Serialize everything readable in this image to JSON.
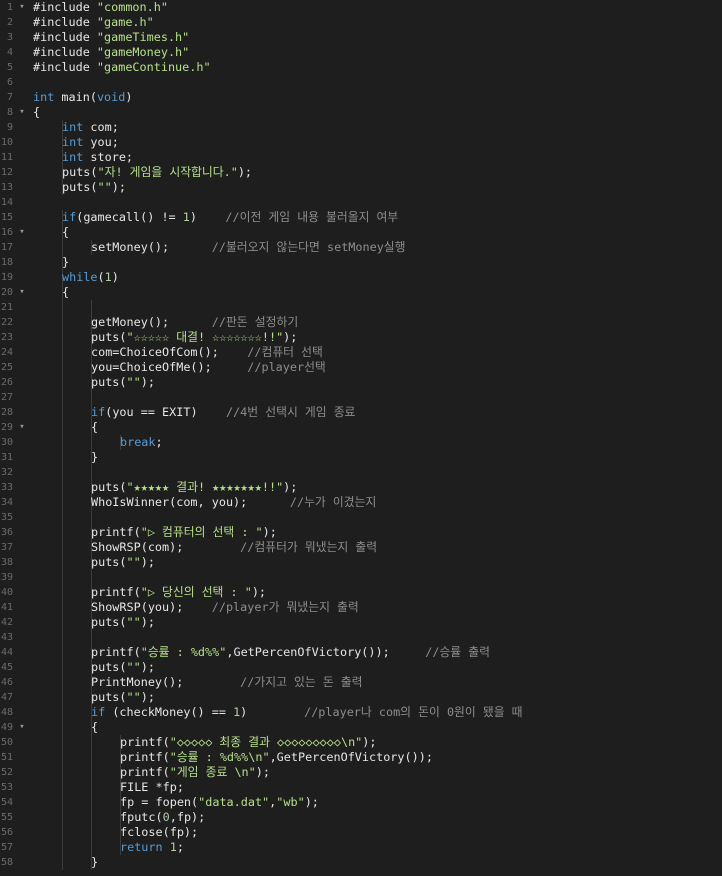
{
  "editor": {
    "colors": {
      "background": "#1e1e1e",
      "keyword": "#569cd6",
      "string": "#b5e08a",
      "comment": "#8e8e8e",
      "number": "#b5cea8",
      "plain": "#e6e6e6",
      "line_number": "#6b6b6b"
    },
    "lines": [
      {
        "n": "1",
        "fold": true,
        "depth": 0,
        "toks": [
          [
            "p",
            "#include "
          ],
          [
            "s",
            "\"common.h\""
          ]
        ]
      },
      {
        "n": "2",
        "depth": 0,
        "toks": [
          [
            "p",
            "#include "
          ],
          [
            "s",
            "\"game.h\""
          ]
        ]
      },
      {
        "n": "3",
        "depth": 0,
        "toks": [
          [
            "p",
            "#include "
          ],
          [
            "s",
            "\"gameTimes.h\""
          ]
        ]
      },
      {
        "n": "4",
        "depth": 0,
        "toks": [
          [
            "p",
            "#include "
          ],
          [
            "s",
            "\"gameMoney.h\""
          ]
        ]
      },
      {
        "n": "5",
        "depth": 0,
        "toks": [
          [
            "p",
            "#include "
          ],
          [
            "s",
            "\"gameContinue.h\""
          ]
        ]
      },
      {
        "n": "6",
        "depth": 0,
        "toks": []
      },
      {
        "n": "7",
        "depth": 0,
        "toks": [
          [
            "k",
            "int"
          ],
          [
            "p",
            " main("
          ],
          [
            "k",
            "void"
          ],
          [
            "p",
            ")"
          ]
        ]
      },
      {
        "n": "8",
        "fold": true,
        "depth": 0,
        "toks": [
          [
            "p",
            "{"
          ]
        ]
      },
      {
        "n": "9",
        "depth": 2,
        "toks": [
          [
            "k",
            "int"
          ],
          [
            "p",
            " com;"
          ]
        ]
      },
      {
        "n": "10",
        "depth": 2,
        "toks": [
          [
            "k",
            "int"
          ],
          [
            "p",
            " you;"
          ]
        ]
      },
      {
        "n": "11",
        "depth": 2,
        "toks": [
          [
            "k",
            "int"
          ],
          [
            "p",
            " store;"
          ]
        ]
      },
      {
        "n": "12",
        "depth": 2,
        "toks": [
          [
            "p",
            "puts("
          ],
          [
            "s",
            "\"자! 게임을 시작합니다.\""
          ],
          [
            "p",
            ");"
          ]
        ]
      },
      {
        "n": "13",
        "depth": 2,
        "toks": [
          [
            "p",
            "puts("
          ],
          [
            "s",
            "\"\""
          ],
          [
            "p",
            ");"
          ]
        ]
      },
      {
        "n": "14",
        "depth": 1,
        "toks": []
      },
      {
        "n": "15",
        "depth": 2,
        "toks": [
          [
            "k",
            "if"
          ],
          [
            "p",
            "(gamecall() != "
          ],
          [
            "n",
            "1"
          ],
          [
            "p",
            ")    "
          ],
          [
            "c",
            "//이전 게임 내용 불러올지 여부"
          ]
        ]
      },
      {
        "n": "16",
        "fold": true,
        "depth": 2,
        "toks": [
          [
            "p",
            "{"
          ]
        ]
      },
      {
        "n": "17",
        "depth": 3,
        "toks": [
          [
            "p",
            "setMoney();      "
          ],
          [
            "c",
            "//불러오지 않는다면 setMoney실행"
          ]
        ]
      },
      {
        "n": "18",
        "depth": 2,
        "toks": [
          [
            "p",
            "}"
          ]
        ]
      },
      {
        "n": "19",
        "depth": 2,
        "toks": [
          [
            "k",
            "while"
          ],
          [
            "p",
            "("
          ],
          [
            "n",
            "1"
          ],
          [
            "p",
            ")"
          ]
        ]
      },
      {
        "n": "20",
        "fold": true,
        "depth": 2,
        "toks": [
          [
            "p",
            "{"
          ]
        ]
      },
      {
        "n": "21",
        "depth": 3,
        "toks": []
      },
      {
        "n": "22",
        "depth": 3,
        "toks": [
          [
            "p",
            "getMoney();      "
          ],
          [
            "c",
            "//판돈 설정하기"
          ]
        ]
      },
      {
        "n": "23",
        "depth": 3,
        "toks": [
          [
            "p",
            "puts("
          ],
          [
            "s",
            "\"☆☆☆☆☆ 대결! ☆☆☆☆☆☆☆!!\""
          ],
          [
            "p",
            ");"
          ]
        ]
      },
      {
        "n": "24",
        "depth": 3,
        "toks": [
          [
            "p",
            "com=ChoiceOfCom();    "
          ],
          [
            "c",
            "//컴퓨터 선택"
          ]
        ]
      },
      {
        "n": "25",
        "depth": 3,
        "toks": [
          [
            "p",
            "you=ChoiceOfMe();     "
          ],
          [
            "c",
            "//player선택"
          ]
        ]
      },
      {
        "n": "26",
        "depth": 3,
        "toks": [
          [
            "p",
            "puts("
          ],
          [
            "s",
            "\"\""
          ],
          [
            "p",
            ");"
          ]
        ]
      },
      {
        "n": "27",
        "depth": 3,
        "toks": []
      },
      {
        "n": "28",
        "depth": 3,
        "toks": [
          [
            "k",
            "if"
          ],
          [
            "p",
            "(you == EXIT)    "
          ],
          [
            "c",
            "//4번 선택시 게임 종료"
          ]
        ]
      },
      {
        "n": "29",
        "fold": true,
        "depth": 3,
        "toks": [
          [
            "p",
            "{"
          ]
        ]
      },
      {
        "n": "30",
        "depth": 4,
        "toks": [
          [
            "k",
            "break"
          ],
          [
            "p",
            ";"
          ]
        ]
      },
      {
        "n": "31",
        "depth": 3,
        "toks": [
          [
            "p",
            "}"
          ]
        ]
      },
      {
        "n": "32",
        "depth": 3,
        "toks": []
      },
      {
        "n": "33",
        "depth": 3,
        "toks": [
          [
            "p",
            "puts("
          ],
          [
            "s",
            "\"★★★★★ 결과! ★★★★★★★!!\""
          ],
          [
            "p",
            ");"
          ]
        ]
      },
      {
        "n": "34",
        "depth": 3,
        "toks": [
          [
            "p",
            "WhoIsWinner(com, you);      "
          ],
          [
            "c",
            "//누가 이겼는지"
          ]
        ]
      },
      {
        "n": "35",
        "depth": 3,
        "toks": []
      },
      {
        "n": "36",
        "depth": 3,
        "toks": [
          [
            "p",
            "printf("
          ],
          [
            "s",
            "\"▷ 컴퓨터의 선택 : \""
          ],
          [
            "p",
            ");"
          ]
        ]
      },
      {
        "n": "37",
        "depth": 3,
        "toks": [
          [
            "p",
            "ShowRSP(com);        "
          ],
          [
            "c",
            "//컴퓨터가 뭐냈는지 출력"
          ]
        ]
      },
      {
        "n": "38",
        "depth": 3,
        "toks": [
          [
            "p",
            "puts("
          ],
          [
            "s",
            "\"\""
          ],
          [
            "p",
            ");"
          ]
        ]
      },
      {
        "n": "39",
        "depth": 3,
        "toks": []
      },
      {
        "n": "40",
        "depth": 3,
        "toks": [
          [
            "p",
            "printf("
          ],
          [
            "s",
            "\"▷ 당신의 선택 : \""
          ],
          [
            "p",
            ");"
          ]
        ]
      },
      {
        "n": "41",
        "depth": 3,
        "toks": [
          [
            "p",
            "ShowRSP(you);    "
          ],
          [
            "c",
            "//player가 뭐냈는지 출력"
          ]
        ]
      },
      {
        "n": "42",
        "depth": 3,
        "toks": [
          [
            "p",
            "puts("
          ],
          [
            "s",
            "\"\""
          ],
          [
            "p",
            ");"
          ]
        ]
      },
      {
        "n": "43",
        "depth": 3,
        "toks": []
      },
      {
        "n": "44",
        "depth": 3,
        "toks": [
          [
            "p",
            "printf("
          ],
          [
            "s",
            "\"승률 : %d%%\""
          ],
          [
            "p",
            ",GetPercenOfVictory());     "
          ],
          [
            "c",
            "//승률 출력"
          ]
        ]
      },
      {
        "n": "45",
        "depth": 3,
        "toks": [
          [
            "p",
            "puts("
          ],
          [
            "s",
            "\"\""
          ],
          [
            "p",
            ");"
          ]
        ]
      },
      {
        "n": "46",
        "depth": 3,
        "toks": [
          [
            "p",
            "PrintMoney();        "
          ],
          [
            "c",
            "//가지고 있는 돈 출력"
          ]
        ]
      },
      {
        "n": "47",
        "depth": 3,
        "toks": [
          [
            "p",
            "puts("
          ],
          [
            "s",
            "\"\""
          ],
          [
            "p",
            ");"
          ]
        ]
      },
      {
        "n": "48",
        "depth": 3,
        "toks": [
          [
            "k",
            "if"
          ],
          [
            "p",
            " (checkMoney() == "
          ],
          [
            "n",
            "1"
          ],
          [
            "p",
            ")        "
          ],
          [
            "c",
            "//player나 com의 돈이 0원이 됐을 때"
          ]
        ]
      },
      {
        "n": "49",
        "fold": true,
        "depth": 3,
        "toks": [
          [
            "p",
            "{"
          ]
        ]
      },
      {
        "n": "50",
        "depth": 4,
        "toks": [
          [
            "p",
            "printf("
          ],
          [
            "s",
            "\"◇◇◇◇◇ 최종 결과 ◇◇◇◇◇◇◇◇◇\\n\""
          ],
          [
            "p",
            ");"
          ]
        ]
      },
      {
        "n": "51",
        "depth": 4,
        "toks": [
          [
            "p",
            "printf("
          ],
          [
            "s",
            "\"승률 : %d%%\\n\""
          ],
          [
            "p",
            ",GetPercenOfVictory());"
          ]
        ]
      },
      {
        "n": "52",
        "depth": 4,
        "toks": [
          [
            "p",
            "printf("
          ],
          [
            "s",
            "\"게임 종료 \\n\""
          ],
          [
            "p",
            ");"
          ]
        ]
      },
      {
        "n": "53",
        "depth": 4,
        "toks": [
          [
            "p",
            "FILE *fp;"
          ]
        ]
      },
      {
        "n": "54",
        "depth": 4,
        "toks": [
          [
            "p",
            "fp = fopen("
          ],
          [
            "s",
            "\"data.dat\""
          ],
          [
            "p",
            ","
          ],
          [
            "s",
            "\"wb\""
          ],
          [
            "p",
            ");"
          ]
        ]
      },
      {
        "n": "55",
        "depth": 4,
        "toks": [
          [
            "p",
            "fputc("
          ],
          [
            "n",
            "0"
          ],
          [
            "p",
            ",fp);"
          ]
        ]
      },
      {
        "n": "56",
        "depth": 4,
        "toks": [
          [
            "p",
            "fclose(fp);"
          ]
        ]
      },
      {
        "n": "57",
        "depth": 4,
        "toks": [
          [
            "k",
            "return"
          ],
          [
            "p",
            " "
          ],
          [
            "n",
            "1"
          ],
          [
            "p",
            ";"
          ]
        ]
      },
      {
        "n": "58",
        "depth": 3,
        "toks": [
          [
            "p",
            "}"
          ]
        ]
      }
    ]
  }
}
